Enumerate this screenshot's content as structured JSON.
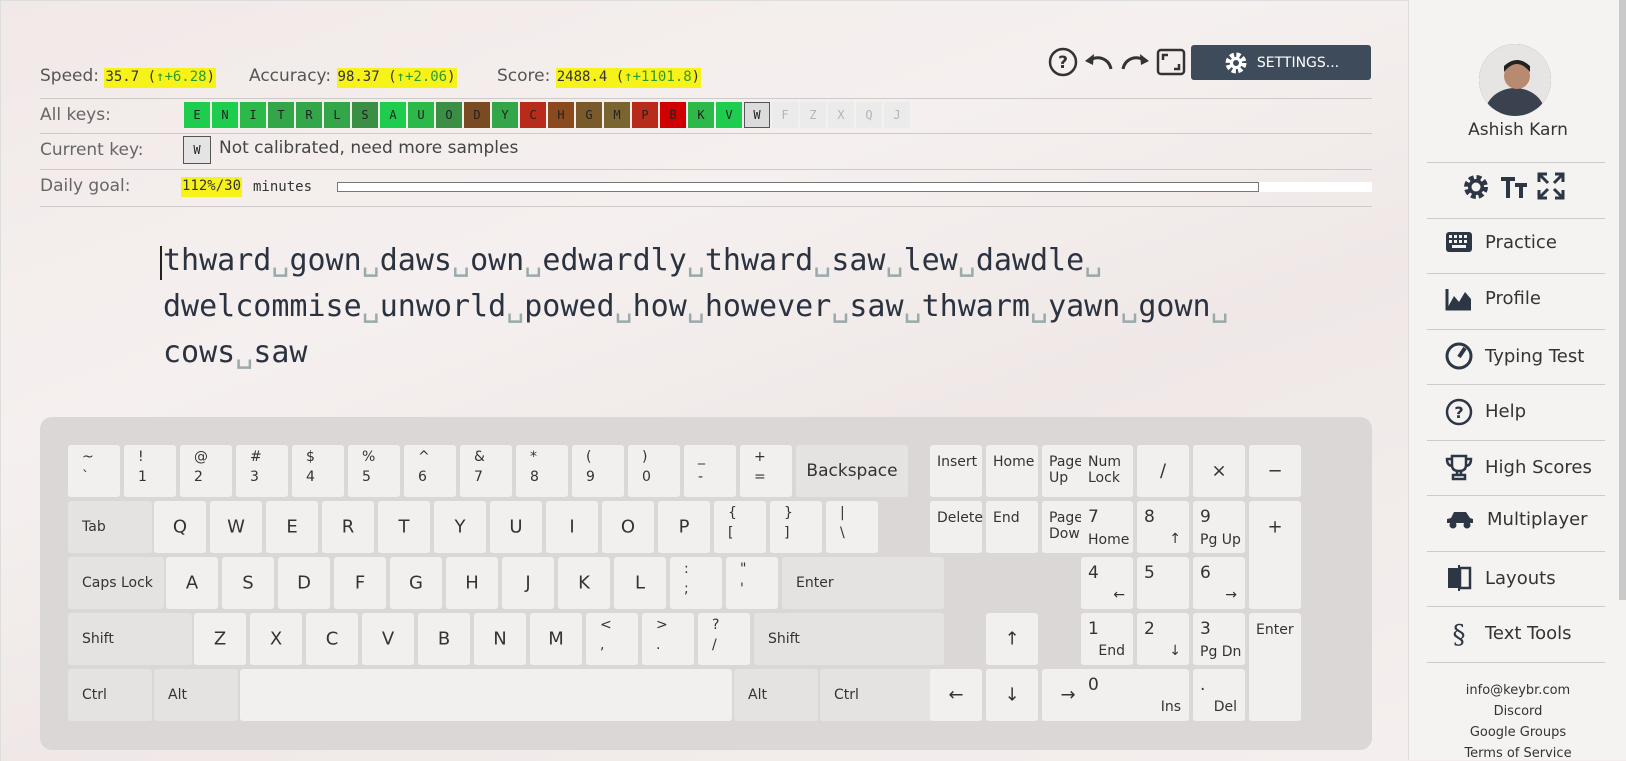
{
  "stats": {
    "speed_label": "Speed:",
    "speed_value": "35.7 (",
    "speed_delta": "↑+6.28",
    "speed_close": ")",
    "accuracy_label": "Accuracy:",
    "accuracy_value": "98.37 (",
    "accuracy_delta": "↑+2.06",
    "accuracy_close": ")",
    "score_label": "Score:",
    "score_value": "2488.4 (",
    "score_delta": "↑+1101.8",
    "score_close": ")"
  },
  "toolbar": {
    "settings_label": "SETTINGS..."
  },
  "all_keys": {
    "label": "All keys:",
    "keys": [
      {
        "k": "E",
        "c": "#1ecc4e"
      },
      {
        "k": "N",
        "c": "#1ecc4e"
      },
      {
        "k": "I",
        "c": "#2db84a"
      },
      {
        "k": "T",
        "c": "#33a64a"
      },
      {
        "k": "R",
        "c": "#33a64a"
      },
      {
        "k": "L",
        "c": "#33a64a"
      },
      {
        "k": "S",
        "c": "#3b8f44"
      },
      {
        "k": "A",
        "c": "#1ecc4e"
      },
      {
        "k": "U",
        "c": "#2db84a"
      },
      {
        "k": "O",
        "c": "#3b8f44"
      },
      {
        "k": "D",
        "c": "#7a4a22"
      },
      {
        "k": "Y",
        "c": "#33a64a"
      },
      {
        "k": "C",
        "c": "#b82a1a"
      },
      {
        "k": "H",
        "c": "#8a4a1e"
      },
      {
        "k": "G",
        "c": "#7a5a2a"
      },
      {
        "k": "M",
        "c": "#7a6430"
      },
      {
        "k": "P",
        "c": "#b82a1a"
      },
      {
        "k": "B",
        "c": "#d00000"
      },
      {
        "k": "K",
        "c": "#2db84a"
      },
      {
        "k": "V",
        "c": "#1ecc4e"
      },
      {
        "k": "W",
        "c": "#dcdcdc"
      },
      {
        "k": "F",
        "c": "#ecebeb"
      },
      {
        "k": "Z",
        "c": "#ecebeb"
      },
      {
        "k": "X",
        "c": "#ecebeb"
      },
      {
        "k": "Q",
        "c": "#ecebeb"
      },
      {
        "k": "J",
        "c": "#ecebeb"
      }
    ]
  },
  "current_key": {
    "label": "Current key:",
    "key": "W",
    "text": "Not calibrated, need more samples"
  },
  "daily_goal": {
    "label": "Daily goal:",
    "value": "112%/30",
    "unit": "minutes",
    "progress": 1.0
  },
  "practice_text": [
    [
      "thward",
      "gown",
      "daws",
      "own",
      "edwardly",
      "thward",
      "saw",
      "lew",
      "dawdle"
    ],
    [
      "dwelcommise",
      "unworld",
      "powed",
      "how",
      "however",
      "saw",
      "thwarm",
      "yawn",
      "gown"
    ],
    [
      "cows",
      "saw"
    ]
  ],
  "space_glyph": "␣",
  "keyboard": {
    "row1": [
      [
        "~",
        "`"
      ],
      [
        "!",
        "1"
      ],
      [
        "@",
        "2"
      ],
      [
        "#",
        "3"
      ],
      [
        "$",
        "4"
      ],
      [
        "%",
        "5"
      ],
      [
        "^",
        "6"
      ],
      [
        "&",
        "7"
      ],
      [
        "*",
        "8"
      ],
      [
        "(",
        "9"
      ],
      [
        ")",
        "0"
      ],
      [
        "_",
        "-"
      ],
      [
        "+",
        "="
      ]
    ],
    "backspace": "Backspace",
    "tab": "Tab",
    "row2": [
      "Q",
      "W",
      "E",
      "R",
      "T",
      "Y",
      "U",
      "I",
      "O",
      "P"
    ],
    "row2_sym": [
      [
        "{",
        "["
      ],
      [
        "}",
        "]"
      ],
      [
        "|",
        "\\"
      ]
    ],
    "caps": "Caps Lock",
    "row3": [
      "A",
      "S",
      "D",
      "F",
      "G",
      "H",
      "J",
      "K",
      "L"
    ],
    "row3_sym": [
      [
        ":",
        ";"
      ],
      [
        "\"",
        "'"
      ]
    ],
    "enter": "Enter",
    "shift": "Shift",
    "row4": [
      "Z",
      "X",
      "C",
      "V",
      "B",
      "N",
      "M"
    ],
    "row4_sym": [
      [
        "<",
        ","
      ],
      [
        ">",
        "."
      ],
      [
        "?",
        "/"
      ]
    ],
    "ctrl": "Ctrl",
    "alt": "Alt",
    "nav": {
      "insert": "Insert",
      "home": "Home",
      "pgup": "Page Up",
      "delete": "Delete",
      "end": "End",
      "pgdn": "Page Down",
      "up": "↑",
      "left": "←",
      "down": "↓",
      "right": "→"
    },
    "numpad": {
      "numlock": "Num Lock",
      "div": "/",
      "mul": "×",
      "minus": "−",
      "plus": "+",
      "enter": "Enter",
      "n7": "7",
      "n7s": "Home",
      "n8": "8",
      "n8s": "↑",
      "n9": "9",
      "n9s": "Pg Up",
      "n4": "4",
      "n4s": "←",
      "n5": "5",
      "n6": "6",
      "n6s": "→",
      "n1": "1",
      "n1s": "End",
      "n2": "2",
      "n2s": "↓",
      "n3": "3",
      "n3s": "Pg Dn",
      "n0": "0",
      "n0s": "Ins",
      "dot": ".",
      "dots": "Del"
    }
  },
  "sidebar": {
    "user_name": "Ashish Karn",
    "nav": [
      {
        "label": "Practice",
        "icon": "keyboard-icon"
      },
      {
        "label": "Profile",
        "icon": "chart-icon"
      },
      {
        "label": "Typing Test",
        "icon": "speedometer-icon"
      },
      {
        "label": "Help",
        "icon": "help-icon"
      },
      {
        "label": "High Scores",
        "icon": "trophy-icon"
      },
      {
        "label": "Multiplayer",
        "icon": "car-icon"
      },
      {
        "label": "Layouts",
        "icon": "layouts-icon"
      },
      {
        "label": "Text Tools",
        "icon": "section-icon"
      }
    ],
    "footer": [
      "info@keybr.com",
      "Discord",
      "Google Groups",
      "Terms of Service"
    ]
  },
  "colors": {
    "highlight": "#f6f21a",
    "delta": "#2e9b2e",
    "settings_bg": "#3d4b5a"
  }
}
